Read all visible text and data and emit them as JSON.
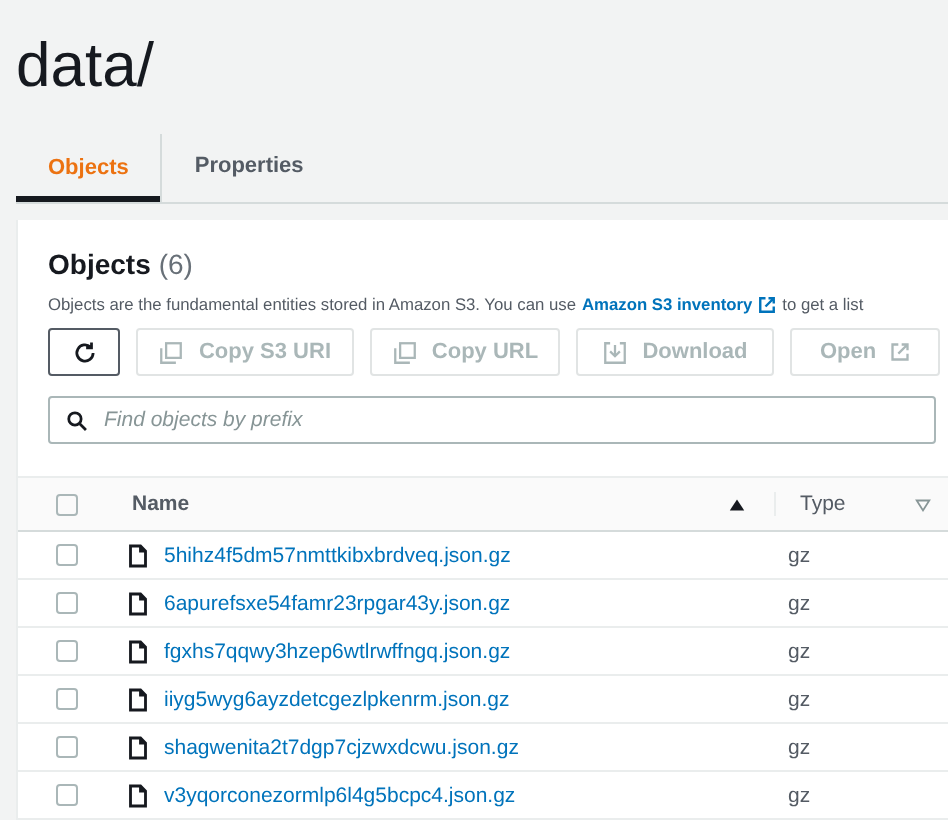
{
  "title": "data/",
  "tabs": [
    {
      "label": "Objects",
      "selected": true
    },
    {
      "label": "Properties",
      "selected": false
    }
  ],
  "panel": {
    "heading": "Objects",
    "count": "(6)",
    "description": "Objects are the fundamental entities stored in Amazon S3. You can use",
    "link": "Amazon S3 inventory",
    "description_end": "to get a list",
    "buttons": [
      {
        "kind": "refresh",
        "disabled": false
      },
      {
        "kind": "copy",
        "label": "Copy S3 URI",
        "disabled": true
      },
      {
        "kind": "copy",
        "label": "Copy URL",
        "disabled": true
      },
      {
        "kind": "download",
        "label": "Download",
        "disabled": true
      },
      {
        "kind": "open",
        "label": "Open",
        "disabled": true
      }
    ],
    "search": {
      "placeholder": "Find objects by prefix"
    }
  },
  "table": {
    "select_all_checked": false,
    "columns": [
      {
        "label": "Name",
        "sorted": true
      },
      {
        "label": "Type",
        "sorted": false
      }
    ],
    "rows": [
      {
        "name": "5hihz4f5dm57nmttkibxbrdveq.json.gz",
        "type": "gz",
        "checked": false
      },
      {
        "name": "6apurefsxe54famr23rpgar43y.json.gz",
        "type": "gz",
        "checked": false
      },
      {
        "name": "fgxhs7qqwy3hzep6wtlrwffngq.json.gz",
        "type": "gz",
        "checked": false
      },
      {
        "name": "iiyg5wyg6ayzdetcgezlpkenrm.json.gz",
        "type": "gz",
        "checked": false
      },
      {
        "name": "shagwenita2t7dgp7cjzwxdcwu.json.gz",
        "type": "gz",
        "checked": false
      },
      {
        "name": "v3yqorconezormlp6l4g5bcpc4.json.gz",
        "type": "gz",
        "checked": false
      }
    ]
  }
}
